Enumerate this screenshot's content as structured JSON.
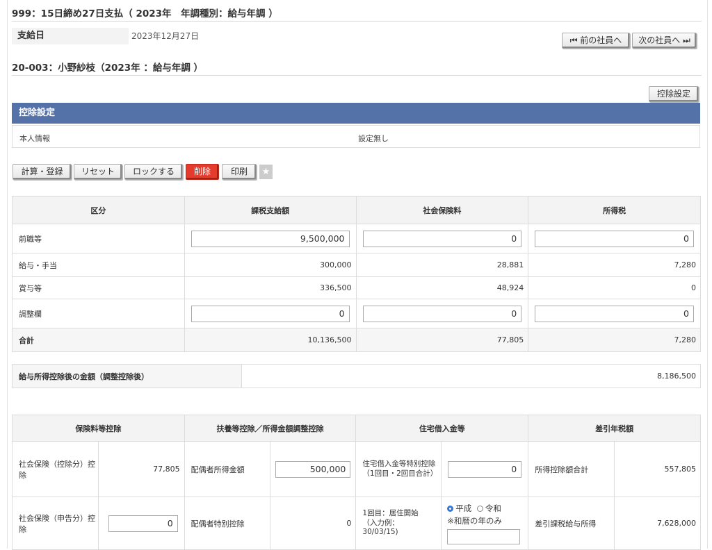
{
  "header": {
    "title": "999：15日締め27日支払（ 2023年　年調種別：給与年調 ）",
    "pay_date_label": "支給日",
    "pay_date": "2023年12月27日",
    "prev_button": "⏮ 前の社員へ",
    "next_button": "次の社員へ ⏭",
    "employee_title": "20-003：小野紗枝（2023年 ：給与年調 ）",
    "deduction_settings_button": "控除設定"
  },
  "deduction_section": {
    "title": "控除設定",
    "personal_label": "本人情報",
    "personal_value": "設定無し"
  },
  "toolbar": {
    "calc_button": "計算・登録",
    "reset_button": "リセット",
    "lock_button": "ロックする",
    "delete_button": "削除",
    "print_button": "印刷",
    "favorite_icon": "★"
  },
  "summary_table": {
    "headers": [
      "区分",
      "課税支給額",
      "社会保険料",
      "所得税"
    ],
    "rows": [
      {
        "label": "前職等",
        "taxable": "9,500,000",
        "social": "0",
        "tax": "0"
      },
      {
        "label": "給与・手当",
        "taxable": "300,000",
        "social": "28,881",
        "tax": "7,280"
      },
      {
        "label": "賞与等",
        "taxable": "336,500",
        "social": "48,924",
        "tax": "0"
      },
      {
        "label": "調整欄",
        "taxable": "0",
        "social": "0",
        "tax": "0"
      },
      {
        "label": "合計",
        "taxable": "10,136,500",
        "social": "77,805",
        "tax": "7,280"
      }
    ]
  },
  "after_deduction": {
    "label": "給与所得控除後の金額（調整控除後）",
    "value": "8,186,500"
  },
  "deduction_table": {
    "headers": [
      "保険料等控除",
      "扶養等控除／所得金額調整控除",
      "住宅借入金等",
      "差引年税額"
    ],
    "row1": {
      "social_label": "社会保険（控除分）控除",
      "social_value": "77,805",
      "spouse_income_label": "配偶者所得金額",
      "spouse_income_value": "500,000",
      "housing_label": "住宅借入金等特別控除\n（1回目・2回目合計）",
      "housing_value": "0",
      "total_label": "所得控除額合計",
      "total_value": "557,805"
    },
    "row2": {
      "social_label": "社会保険（申告分）控除",
      "social_value": "0",
      "spouse_special_label": "配偶者特別控除",
      "spouse_special_value": "0",
      "start_label": "1回目：居住開始\n（入力例：\n30/03/15)",
      "era_heisei": "平成",
      "era_reiwa": "令和",
      "era_note": "※和暦の年のみ",
      "net_label": "差引課税給与所得",
      "net_value": "7,628,000"
    }
  },
  "colors": {
    "section_head": "#5572a8",
    "delete_button": "#e53b2c",
    "radio_selected": "#3478d6"
  }
}
